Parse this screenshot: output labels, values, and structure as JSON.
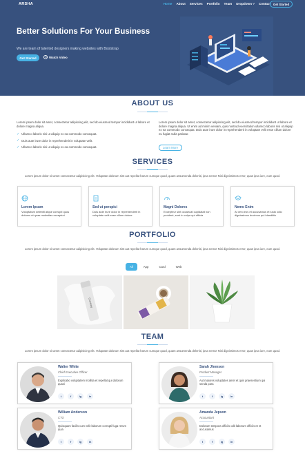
{
  "header": {
    "logo": "ARSHA",
    "menu": [
      "Home",
      "About",
      "Services",
      "Portfolio",
      "Team",
      "Dropdown ˅",
      "Contact"
    ],
    "cta": "Get Started"
  },
  "hero": {
    "title": "Better Solutions For Your Business",
    "subtitle": "We are team of talented designers making websites with Bootstrap",
    "start_button": "Get Started",
    "watch_label": "Watch Video"
  },
  "about": {
    "title": "ABOUT US",
    "intro": "Lorem ipsum dolor sit amet, consectetur adipiscing elit, sed do eiusmod tempor incididunt ut labore et dolore magna aliqua.",
    "list": [
      "Ullamco laboris nisi ut aliquip ex ea commodo consequat.",
      "Duis aute irure dolor in reprehenderit in voluptate velit.",
      "Ullamco laboris nisi ut aliquip ex ea commodo consequat."
    ],
    "right_text": "Lorem ipsum dolor sit amet, consectetur adipiscing elit, sed do eiusmod tempor incididunt ut labore et dolore magna aliqua. Ut enim ad minim veniam, quis nostrud exercitation ullamco laboris nisi ut aliquip ex ea commodo consequat. Duis aute irure dolor in reprehenderit in voluptate velit esse cillum dolore eu fugiat nulla pariatur.",
    "button": "Learn More"
  },
  "services": {
    "title": "SERVICES",
    "text": "Lorem ipsum dolor sit amet consectetur adipisicing elit. Voluptate dolorum sint aut repellat harum cumque quod, quam assumenda deleniti, ipsa nemo! Nisi dignissimos error, quas ipsa iure, eum quod.",
    "items": [
      {
        "title": "Lorem Ipsum",
        "desc": "Voluptatum deleniti atque corrupti quos dolores et quas molestias excepturi"
      },
      {
        "title": "Sed ut perspici",
        "desc": "Duis aute irure dolor in reprehenderit in voluptate velit esse cillum dolore"
      },
      {
        "title": "Magni Dolores",
        "desc": "Excepteur sint occaecat cupidatat non proident, sunt in culpa qui officia"
      },
      {
        "title": "Nemo Enim",
        "desc": "At vero eos et accusamus et iusto odio dignissimos ducimus qui blanditiis"
      }
    ]
  },
  "portfolio": {
    "title": "PORTFOLIO",
    "text": "Lorem ipsum dolor sit amet consectetur adipisicing elit. Voluptate dolorum sint aut repellat harum cumque quod, quam assumenda deleniti, ipsa nemo! Nisi dignissimos error, quas ipsa iure, eum quod.",
    "filters": [
      "All",
      "App",
      "Card",
      "Web"
    ],
    "bottle_text": "Cuvaroy"
  },
  "team": {
    "title": "TEAM",
    "text": "Lorem ipsum dolor sit amet consectetur adipisicing elit. Voluptate dolorum sint aut repellat harum cumque quod, quam assumenda deleniti, ipsa nemo! Nisi dignissimos error, quas ipsa iure, eum quod.",
    "members": [
      {
        "name": "Walter White",
        "role": "Chief Executive Officer",
        "desc": "Explicabo voluptatem mollitia et repellat qui dolorum quasi"
      },
      {
        "name": "Sarah Jhonson",
        "role": "Product Manager",
        "desc": "Aut maiores voluptates amet et quis praesentium qui senda para"
      },
      {
        "name": "William Anderson",
        "role": "CTO",
        "desc": "Quisquam facilis cum velit laborum corrupti fuga rerum quia"
      },
      {
        "name": "Amanda Jepson",
        "role": "Accountant",
        "desc": "Dolorum tempora officiis odit laborum officiis et et accusamus"
      }
    ],
    "socials": [
      "t",
      "f",
      "ig",
      "in"
    ]
  },
  "colors": {
    "primary": "#37517e",
    "accent": "#47b2e4"
  }
}
